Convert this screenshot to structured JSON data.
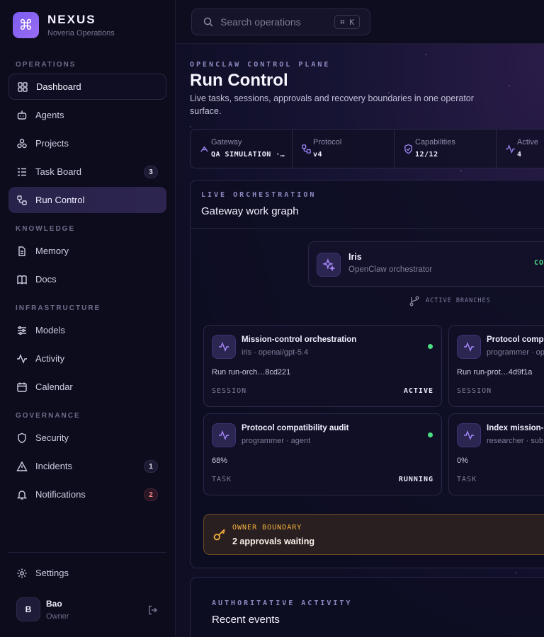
{
  "brand": {
    "name": "NEXUS",
    "subtitle": "Noveria Operations",
    "logo_glyph": "⌘"
  },
  "sidebar": {
    "sections": [
      "OPERATIONS",
      "KNOWLEDGE",
      "INFRASTRUCTURE",
      "GOVERNANCE"
    ],
    "items": [
      {
        "label": "Dashboard",
        "icon": "dashboard-icon"
      },
      {
        "label": "Agents",
        "icon": "bot-icon"
      },
      {
        "label": "Projects",
        "icon": "projects-icon"
      },
      {
        "label": "Task Board",
        "icon": "task-list-icon",
        "badge": "3"
      },
      {
        "label": "Run Control",
        "icon": "workflow-icon"
      },
      {
        "label": "Memory",
        "icon": "file-icon"
      },
      {
        "label": "Docs",
        "icon": "book-icon"
      },
      {
        "label": "Models",
        "icon": "sliders-icon"
      },
      {
        "label": "Activity",
        "icon": "activity-icon"
      },
      {
        "label": "Calendar",
        "icon": "calendar-icon"
      },
      {
        "label": "Security",
        "icon": "shield-icon"
      },
      {
        "label": "Incidents",
        "icon": "alert-icon",
        "badge": "1"
      },
      {
        "label": "Notifications",
        "icon": "bell-icon",
        "badge": "2"
      }
    ],
    "settings_label": "Settings",
    "user": {
      "initial": "B",
      "name": "Bao",
      "role": "Owner"
    }
  },
  "search": {
    "placeholder": "Search operations",
    "shortcut": "⌘ K"
  },
  "header": {
    "eyebrow": "OPENCLAW CONTROL PLANE",
    "title": "Run Control",
    "description": "Live tasks, sessions, approvals and recovery boundaries in one operator surface."
  },
  "stats": [
    {
      "label": "Gateway",
      "value": "QA SIMULATION ·…",
      "icon": "gateway-icon"
    },
    {
      "label": "Protocol",
      "value": "v4",
      "icon": "workflow-icon"
    },
    {
      "label": "Capabilities",
      "value": "12/12",
      "icon": "shield-check-icon"
    },
    {
      "label": "Active",
      "value": "4",
      "icon": "activity-icon"
    }
  ],
  "orchestration": {
    "eyebrow": "LIVE ORCHESTRATION",
    "title": "Gateway work graph",
    "orchestrator": {
      "name": "Iris",
      "subtitle": "OpenClaw orchestrator",
      "status": "CON"
    },
    "branches_label": "ACTIVE BRANCHES",
    "cards": [
      {
        "title": "Mission-control orchestration",
        "subtitle": "iris · openai/gpt-5.4",
        "detail": "Run run-orch…8cd221",
        "kind": "SESSION",
        "state": "ACTIVE"
      },
      {
        "title": "Protocol compa",
        "subtitle": "programmer · op",
        "detail": "Run run-prot…4d9f1a",
        "kind": "SESSION",
        "state": ""
      },
      {
        "title": "Protocol compatibility audit",
        "subtitle": "programmer · agent",
        "detail": "68%",
        "kind": "TASK",
        "state": "RUNNING"
      },
      {
        "title": "Index mission-c",
        "subtitle": "researcher · sub",
        "detail": "0%",
        "kind": "TASK",
        "state": ""
      }
    ],
    "boundary": {
      "label": "OWNER BOUNDARY",
      "text": "2 approvals waiting"
    }
  },
  "activity": {
    "eyebrow": "AUTHORITATIVE ACTIVITY",
    "title": "Recent events"
  },
  "colors": {
    "accent": "#7b5cf0",
    "success": "#4ade80",
    "warning": "#f5b340",
    "danger": "#ff8a8a"
  }
}
